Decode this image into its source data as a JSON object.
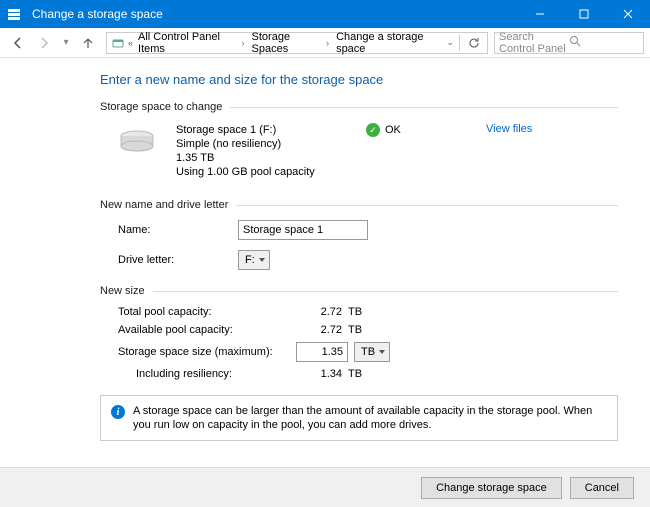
{
  "window": {
    "title": "Change a storage space"
  },
  "breadcrumb": {
    "root_hint": "«",
    "items": [
      "All Control Panel Items",
      "Storage Spaces",
      "Change a storage space"
    ]
  },
  "search": {
    "placeholder": "Search Control Panel"
  },
  "page": {
    "heading": "Enter a new name and size for the storage space"
  },
  "section_change": {
    "legend": "Storage space to change",
    "name_line": "Storage space 1 (F:)",
    "resiliency": "Simple (no resiliency)",
    "size": "1.35 TB",
    "pool_usage": "Using 1.00 GB pool capacity",
    "status": "OK",
    "view_files": "View files"
  },
  "section_name": {
    "legend": "New name and drive letter",
    "name_label": "Name:",
    "name_value": "Storage space 1",
    "letter_label": "Drive letter:",
    "letter_value": "F:"
  },
  "section_size": {
    "legend": "New size",
    "total_label": "Total pool capacity:",
    "total_value": "2.72",
    "total_unit": "TB",
    "avail_label": "Available pool capacity:",
    "avail_value": "2.72",
    "avail_unit": "TB",
    "max_label": "Storage space size (maximum):",
    "max_value": "1.35",
    "max_unit": "TB",
    "resil_label": "Including resiliency:",
    "resil_value": "1.34",
    "resil_unit": "TB"
  },
  "info": {
    "message": "A storage space can be larger than the amount of available capacity in the storage pool. When you run low on capacity in the pool, you can add more drives."
  },
  "footer": {
    "primary": "Change storage space",
    "cancel": "Cancel"
  }
}
